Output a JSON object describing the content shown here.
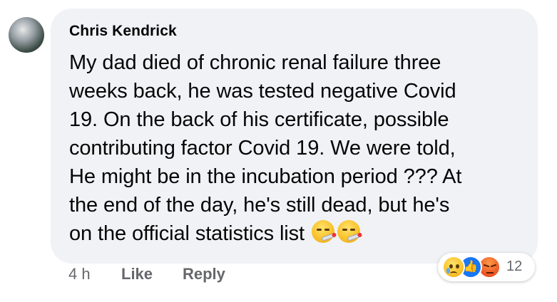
{
  "comment": {
    "author": "Chris Kendrick",
    "lines": [
      "My dad died of chronic renal failure three",
      "weeks back, he was tested negative Covid",
      "19. On the back of his certificate, possible",
      "contributing factor Covid 19. We were told,",
      "He might be in the incubation period ???  At",
      "the end of the day, he's still dead, but he's",
      "on the official statistics list"
    ],
    "inline_emojis": [
      "face-with-thermometer-icon",
      "face-with-thermometer-icon"
    ]
  },
  "meta": {
    "time": "4 h",
    "like_label": "Like",
    "reply_label": "Reply"
  },
  "reactions": {
    "icons": [
      "sad-reaction-icon",
      "like-reaction-icon",
      "angry-reaction-icon"
    ],
    "count": "12"
  }
}
